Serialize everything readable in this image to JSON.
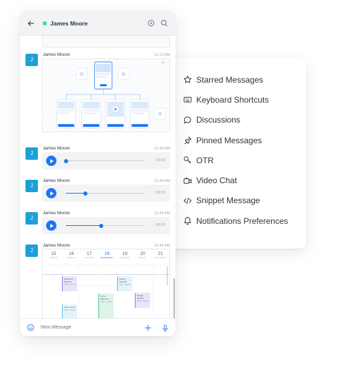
{
  "chat": {
    "contact_name": "James Moore",
    "status_color": "#2de0a5",
    "composer_placeholder": "New Message",
    "messages": [
      {
        "author": "James Moore",
        "time": "11:12 AM",
        "avatar": "J",
        "type": "image",
        "badge": "1/2"
      },
      {
        "author": "James Moore",
        "time": "11:43 AM",
        "avatar": "J",
        "type": "audio",
        "duration": "00:00",
        "progress": 0
      },
      {
        "author": "James Moore",
        "time": "11:43 AM",
        "avatar": "J",
        "type": "audio",
        "duration": "00:01",
        "progress": 0.25
      },
      {
        "author": "James Moore",
        "time": "11:44 AM",
        "avatar": "J",
        "type": "audio",
        "duration": "00:01",
        "progress": 0.45
      },
      {
        "author": "James Moore",
        "time": "11:44 AM",
        "avatar": "J",
        "type": "calendar"
      }
    ],
    "calendar": {
      "days": [
        {
          "num": "15",
          "wd": "SUNDAY"
        },
        {
          "num": "16",
          "wd": "MONDAY"
        },
        {
          "num": "17",
          "wd": "TUESDAY"
        },
        {
          "num": "18",
          "wd": "WEDNESDAY"
        },
        {
          "num": "19",
          "wd": "THURSDAY"
        },
        {
          "num": "20",
          "wd": "FRIDAY"
        },
        {
          "num": "21",
          "wd": "SATURDAY"
        }
      ],
      "active_day": "18",
      "events": [
        {
          "title": "Weekend Meeting",
          "sub": "9AM - 10AM"
        },
        {
          "title": "Weekly Standup",
          "sub": "9AM - 10AM"
        },
        {
          "title": "Design Review",
          "sub": "9AM - 10AM"
        },
        {
          "title": "Sprint Planning",
          "sub": "9AM - 10AM"
        },
        {
          "title": "Team Lunch",
          "sub": "9AM - 10AM"
        }
      ]
    }
  },
  "menu": {
    "items": [
      {
        "label": "Starred Messages",
        "icon": "star-icon"
      },
      {
        "label": "Keyboard Shortcuts",
        "icon": "keyboard-icon"
      },
      {
        "label": "Discussions",
        "icon": "discussion-icon"
      },
      {
        "label": "Pinned Messages",
        "icon": "pin-icon"
      },
      {
        "label": "OTR",
        "icon": "key-icon"
      },
      {
        "label": "Video Chat",
        "icon": "video-icon"
      },
      {
        "label": "Snippet Message",
        "icon": "code-icon"
      },
      {
        "label": "Notifications Preferences",
        "icon": "bell-icon"
      }
    ]
  },
  "colors": {
    "accent": "#1d74f5",
    "avatar": "#1d9fd8",
    "online": "#2de0a5"
  }
}
